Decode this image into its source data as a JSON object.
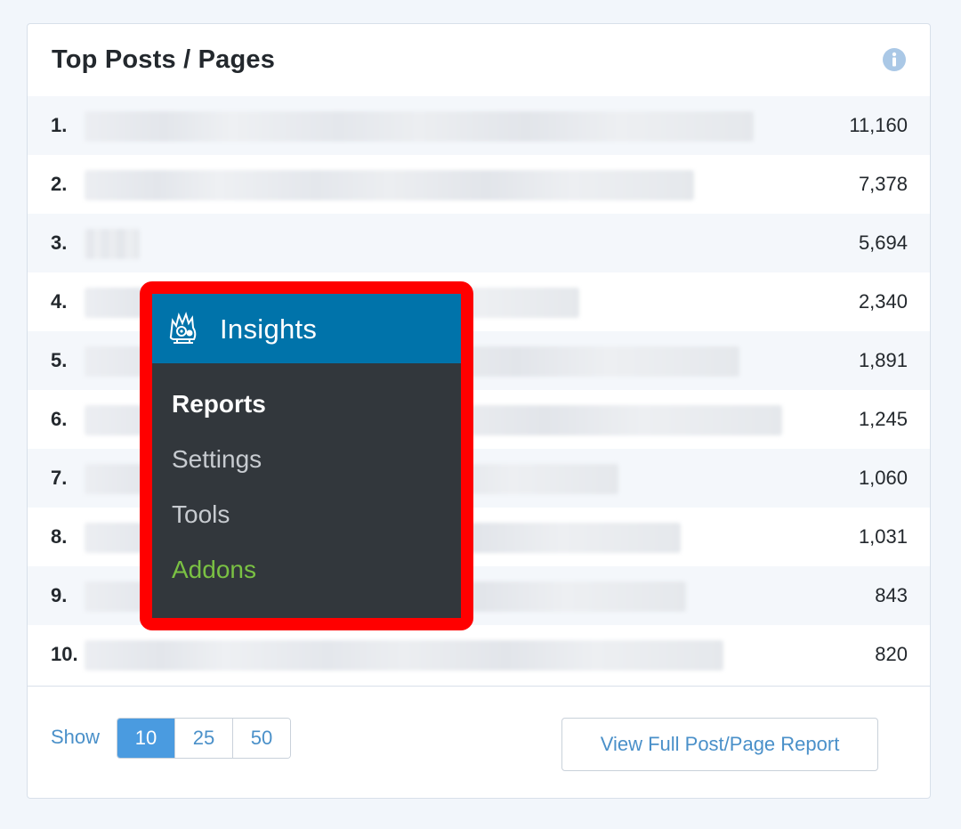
{
  "widget": {
    "title": "Top Posts / Pages",
    "info_icon": "info-icon",
    "rows": [
      {
        "rank": "1.",
        "count": "11,160"
      },
      {
        "rank": "2.",
        "count": "7,378"
      },
      {
        "rank": "3.",
        "count": "5,694"
      },
      {
        "rank": "4.",
        "count": "2,340"
      },
      {
        "rank": "5.",
        "count": "1,891"
      },
      {
        "rank": "6.",
        "count": "1,245"
      },
      {
        "rank": "7.",
        "count": "1,060"
      },
      {
        "rank": "8.",
        "count": "1,031"
      },
      {
        "rank": "9.",
        "count": "843"
      },
      {
        "rank": "10.",
        "count": "820"
      }
    ]
  },
  "footer": {
    "show_label": "Show",
    "page_sizes": [
      "10",
      "25",
      "50"
    ],
    "active_page_size": "10",
    "report_button": "View Full Post/Page Report"
  },
  "menu": {
    "title": "Insights",
    "icon": "monsterinsights-logo-icon",
    "items": [
      "Reports",
      "Settings",
      "Tools",
      "Addons"
    ],
    "highlight_color": "#ff0000",
    "header_color": "#0073aa",
    "addons_color": "#7ac143"
  },
  "colors": {
    "accent": "#4a90c9",
    "active_button": "#4a9be0",
    "menu_background": "#32373c"
  }
}
